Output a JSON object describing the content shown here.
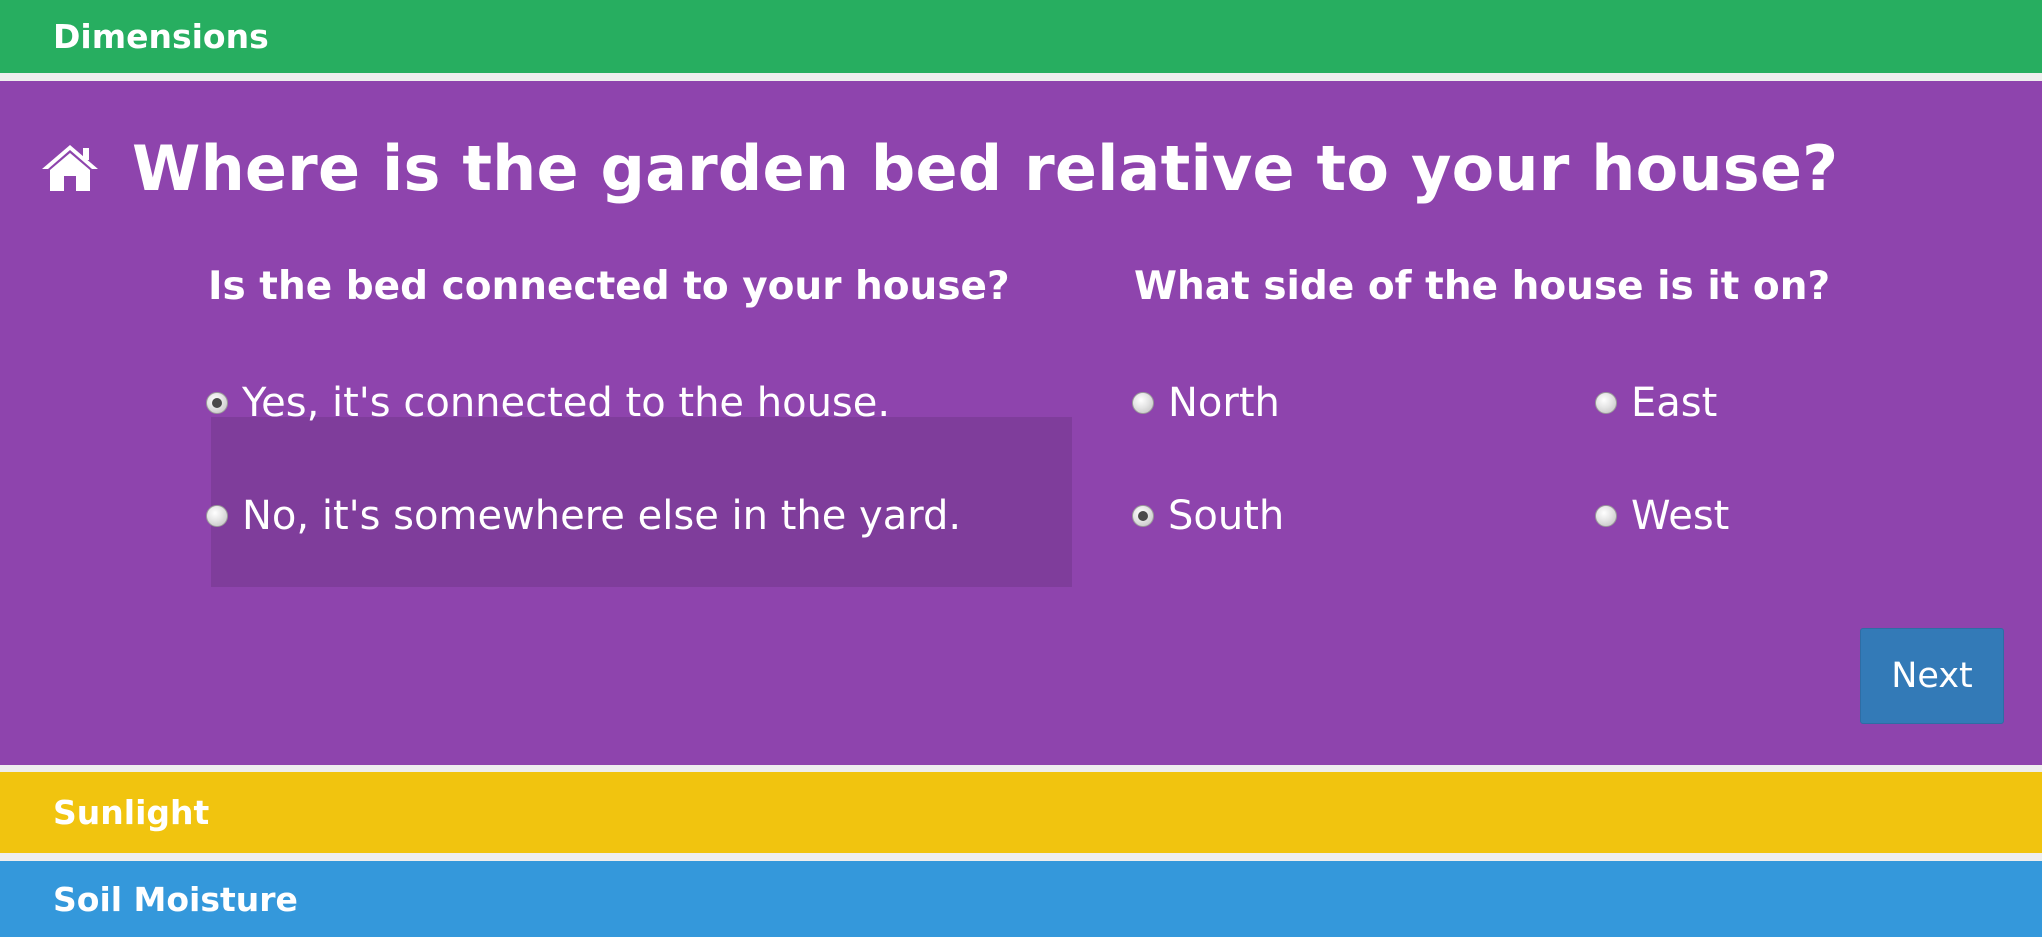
{
  "sections": {
    "dimensions": "Dimensions",
    "sunlight": "Sunlight",
    "soil_moisture": "Soil Moisture"
  },
  "question": {
    "icon": "home-icon",
    "title": "Where is the garden bed relative to your house?"
  },
  "connected": {
    "label": "Is the bed connected to your house?",
    "options": [
      {
        "label": "Yes, it's connected to the house.",
        "selected": true
      },
      {
        "label": "No, it's somewhere else in the yard.",
        "selected": false
      }
    ]
  },
  "side": {
    "label": "What side of the house is it on?",
    "options": [
      {
        "label": "North",
        "selected": false
      },
      {
        "label": "East",
        "selected": false
      },
      {
        "label": "South",
        "selected": true
      },
      {
        "label": "West",
        "selected": false
      }
    ]
  },
  "next_label": "Next",
  "colors": {
    "dimensions": "#27ae60",
    "panel": "#8e44ad",
    "sunlight": "#f1c40f",
    "soil_moisture": "#3498db",
    "button": "#337ab7"
  }
}
